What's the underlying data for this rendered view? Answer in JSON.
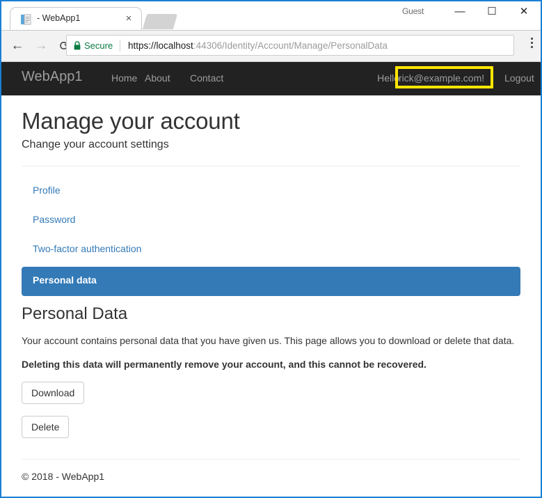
{
  "browser": {
    "tab": {
      "title": "- WebApp1",
      "favicon_icon": "document-icon",
      "close_icon": "×"
    },
    "profile_label": "Guest",
    "window_controls": {
      "minimize": "—",
      "maximize": "☐",
      "close": "✕"
    },
    "toolbar": {
      "back_icon": "←",
      "forward_icon": "→",
      "reload_icon": "⟳",
      "security_label": "Secure",
      "lock_icon": "lock-icon",
      "url_domain": "https://localhost",
      "url_path": ":44306/Identity/Account/Manage/PersonalData",
      "menu_icon": "three-dot-menu-icon"
    }
  },
  "site": {
    "brand": "WebApp1",
    "nav": [
      {
        "label": "Home"
      },
      {
        "label": "About"
      },
      {
        "label": "Contact"
      }
    ],
    "greeting": "Hello",
    "user_email": "rick@example.com!",
    "logout_label": "Logout",
    "highlight_color": "#ffe600"
  },
  "page": {
    "title": "Manage your account",
    "subtitle": "Change your account settings",
    "account_nav": [
      {
        "label": "Profile",
        "active": false
      },
      {
        "label": "Password",
        "active": false
      },
      {
        "label": "Two-factor authentication",
        "active": false
      },
      {
        "label": "Personal data",
        "active": true
      }
    ],
    "section_title": "Personal Data",
    "paragraph": "Your account contains personal data that you have given us. This page allows you to download or delete that data.",
    "warning": "Deleting this data will permanently remove your account, and this cannot be recovered.",
    "download_button": "Download",
    "delete_button": "Delete",
    "footer": "© 2018 - WebApp1",
    "accent_color": "#337ab7",
    "navbar_color": "#222222"
  }
}
